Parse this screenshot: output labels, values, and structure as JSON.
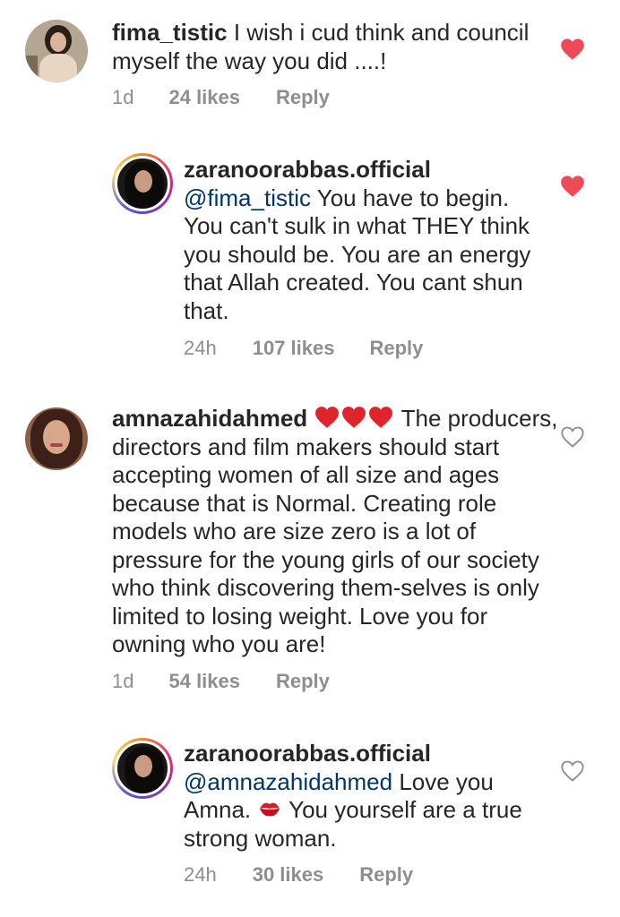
{
  "comments": [
    {
      "username": "fima_tistic",
      "text": " I wish i cud think and council myself the way you did ....!",
      "time": "1d",
      "likes": "24 likes",
      "reply": "Reply",
      "liked": true
    },
    {
      "username": "zaranoorabbas.official",
      "mention": "@fima_tistic",
      "text": " You have to begin. You can't sulk in what THEY think you should be. You are an energy that Allah created. You cant shun that.",
      "time": "24h",
      "likes": "107 likes",
      "reply": "Reply",
      "liked": true
    },
    {
      "username": "amnazahidahmed",
      "text": " The producers, directors and film makers should start accepting women of all size and ages because that is Normal. Creating role models who are size zero is a lot of pressure for the young girls of our society who think discovering them-selves is only limited to losing weight. Love you for owning who you are!",
      "time": "1d",
      "likes": "54 likes",
      "reply": "Reply",
      "liked": false
    },
    {
      "username": "zaranoorabbas.official",
      "mention": "@amnazahidahmed",
      "text_before_emoji": " Love you Amna. ",
      "text_after_emoji": " You yourself are a true strong woman.",
      "time": "24h",
      "likes": "30 likes",
      "reply": "Reply",
      "liked": false
    }
  ],
  "colors": {
    "like_red": "#ed4956",
    "meta_gray": "#8e8e8e",
    "mention_blue": "#003569"
  },
  "icons": {
    "liked": "heart-filled-icon",
    "unliked": "heart-outline-icon",
    "emoji_heart": "red-heart-emoji",
    "emoji_kiss": "kiss-mark-emoji"
  }
}
